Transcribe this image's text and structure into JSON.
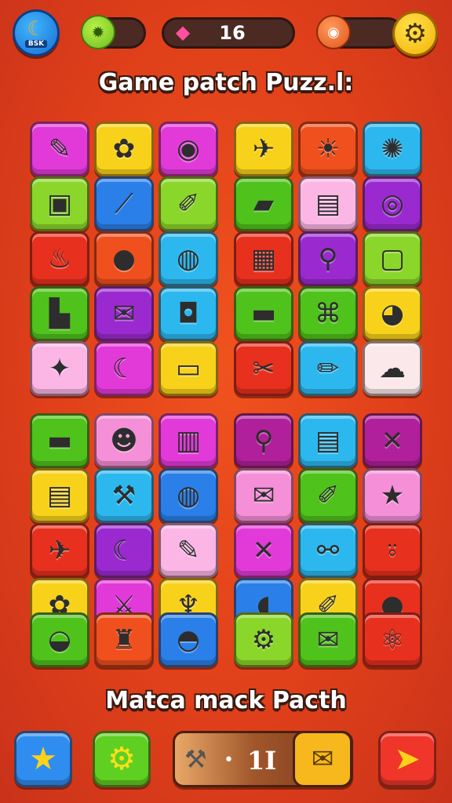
{
  "hud": {
    "avatar_label": "BSK",
    "avatar_icon": "crescent-emblem-icon",
    "gems_icon": "green-gem-icon",
    "moves_icon": "pink-gem-icon",
    "moves_value": "16",
    "coins_icon": "orange-coin-icon",
    "settings_icon": "gear-icon"
  },
  "title_top": "Game patch Puzz.l:",
  "title_bottom": "Matca mack Pacth",
  "colors": {
    "magenta": "#e23ad8",
    "yellow": "#f8d21a",
    "lime": "#8ad62a",
    "green": "#4fc21c",
    "blue": "#2a7fe8",
    "cyan": "#2cb8ee",
    "orange": "#f0501e",
    "red": "#e8301e",
    "purple": "#9a2ad0",
    "pink": "#f58fd8",
    "lightpink": "#fbb6e6",
    "cream": "#fbe8ea",
    "darkmagenta": "#b0209a"
  },
  "tiles": [
    {
      "color": "magenta",
      "icon": "crayon-icon",
      "glyph": "✎"
    },
    {
      "color": "yellow",
      "icon": "cannon-icon",
      "glyph": "✿"
    },
    {
      "color": "magenta",
      "icon": "candy-icon",
      "glyph": "◉"
    },
    {
      "color": "yellow",
      "icon": "rocket-icon",
      "glyph": "✈"
    },
    {
      "color": "orange",
      "icon": "sun-icon",
      "glyph": "☀"
    },
    {
      "color": "cyan",
      "icon": "gear-flower-icon",
      "glyph": "✺"
    },
    {
      "color": "lime",
      "icon": "backpack-icon",
      "glyph": "▣"
    },
    {
      "color": "blue",
      "icon": "bat-icon",
      "glyph": "⟋"
    },
    {
      "color": "lime",
      "icon": "marker-icon",
      "glyph": "✐"
    },
    {
      "color": "green",
      "icon": "cloth-icon",
      "glyph": "▰"
    },
    {
      "color": "lightpink",
      "icon": "bag-icon",
      "glyph": "▤"
    },
    {
      "color": "purple",
      "icon": "ring-icon",
      "glyph": "◎"
    },
    {
      "color": "red",
      "icon": "pot-icon",
      "glyph": "♨"
    },
    {
      "color": "orange",
      "icon": "apple-icon",
      "glyph": "●"
    },
    {
      "color": "cyan",
      "icon": "eye-icon",
      "glyph": "◍"
    },
    {
      "color": "red",
      "icon": "box-stack-icon",
      "glyph": "▦"
    },
    {
      "color": "purple",
      "icon": "magnifier-icon",
      "glyph": "⚲"
    },
    {
      "color": "lime",
      "icon": "tablet-icon",
      "glyph": "▢"
    },
    {
      "color": "green",
      "icon": "stapler-icon",
      "glyph": "▙"
    },
    {
      "color": "purple",
      "icon": "envelope-icon",
      "glyph": "✉"
    },
    {
      "color": "cyan",
      "icon": "camera-icon",
      "glyph": "◘"
    },
    {
      "color": "green",
      "icon": "usb-icon",
      "glyph": "▬"
    },
    {
      "color": "green",
      "icon": "ghost-box-icon",
      "glyph": "⌘"
    },
    {
      "color": "yellow",
      "icon": "donut-icon",
      "glyph": "◕"
    },
    {
      "color": "lightpink",
      "icon": "starfish-icon",
      "glyph": "✦"
    },
    {
      "color": "magenta",
      "icon": "hook-icon",
      "glyph": "☾"
    },
    {
      "color": "yellow",
      "icon": "ticket-icon",
      "glyph": "▭"
    },
    {
      "color": "red",
      "icon": "tools-icon",
      "glyph": "✂"
    },
    {
      "color": "cyan",
      "icon": "pencil-icon",
      "glyph": "✏"
    },
    {
      "color": "cream",
      "icon": "cloud-icon",
      "glyph": "☁"
    },
    {
      "color": "green",
      "icon": "log-icon",
      "glyph": "▬"
    },
    {
      "color": "pink",
      "icon": "frog-icon",
      "glyph": "☻"
    },
    {
      "color": "magenta",
      "icon": "radio-icon",
      "glyph": "▥"
    },
    {
      "color": "darkmagenta",
      "icon": "magnifier-icon",
      "glyph": "⚲"
    },
    {
      "color": "cyan",
      "icon": "chest-icon",
      "glyph": "▤"
    },
    {
      "color": "darkmagenta",
      "icon": "crossed-swords-icon",
      "glyph": "✕"
    },
    {
      "color": "yellow",
      "icon": "document-icon",
      "glyph": "▤"
    },
    {
      "color": "cyan",
      "icon": "shovel-icon",
      "glyph": "⚒"
    },
    {
      "color": "blue",
      "icon": "speech-bubble-icon",
      "glyph": "◍"
    },
    {
      "color": "pink",
      "icon": "map-icon",
      "glyph": "✉"
    },
    {
      "color": "green",
      "icon": "chisel-icon",
      "glyph": "✐"
    },
    {
      "color": "pink",
      "icon": "star-icon",
      "glyph": "★"
    },
    {
      "color": "red",
      "icon": "drill-icon",
      "glyph": "✈"
    },
    {
      "color": "purple",
      "icon": "horn-icon",
      "glyph": "☾"
    },
    {
      "color": "lightpink",
      "icon": "crayon-icon",
      "glyph": "✎"
    },
    {
      "color": "magenta",
      "icon": "crossed-tools-icon",
      "glyph": "✕"
    },
    {
      "color": "cyan",
      "icon": "scissors-icon",
      "glyph": "⚯"
    },
    {
      "color": "red",
      "icon": "joystick-icon",
      "glyph": "⍤"
    },
    {
      "color": "yellow",
      "icon": "flower-icon",
      "glyph": "✿"
    },
    {
      "color": "magenta",
      "icon": "wrench-icon",
      "glyph": "⚔"
    },
    {
      "color": "yellow",
      "icon": "lamp-icon",
      "glyph": "♆"
    },
    {
      "color": "blue",
      "icon": "chat-bubble-icon",
      "glyph": "◖"
    },
    {
      "color": "yellow",
      "icon": "brush-icon",
      "glyph": "✐"
    },
    {
      "color": "red",
      "icon": "coin-icon",
      "glyph": "●"
    },
    {
      "color": "green",
      "icon": "jar-icon",
      "glyph": "◒"
    },
    {
      "color": "orange",
      "icon": "bottle-icon",
      "glyph": "♜"
    },
    {
      "color": "blue",
      "icon": "peach-icon",
      "glyph": "◓"
    },
    {
      "color": "lime",
      "icon": "gear-icon",
      "glyph": "⚙"
    },
    {
      "color": "green",
      "icon": "mail-icon",
      "glyph": "✉"
    },
    {
      "color": "red",
      "icon": "molecule-icon",
      "glyph": "⚛"
    }
  ],
  "bottom": {
    "star_icon": "star-icon",
    "gear_icon": "gear-icon",
    "boost_tool_icon": "hammer-icon",
    "boost_value": "1I",
    "message_icon": "envelope-icon",
    "play_icon": "arrow-icon"
  }
}
